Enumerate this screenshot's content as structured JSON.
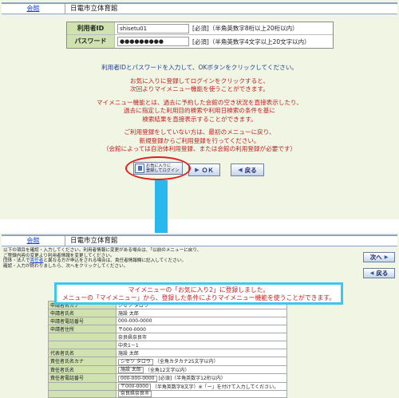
{
  "top": {
    "header": {
      "link": "会館",
      "title": "日電市立体育館"
    },
    "login": {
      "id_label": "利用者ID",
      "id_value": "shisetu01",
      "id_hint": "[必須]（半角英数字8桁以上20桁以内）",
      "pw_label": "パスワード",
      "pw_value": "●●●●●●●●●",
      "pw_hint": "[必須]（半角英数字4文字以上20文字以内）"
    },
    "messages": {
      "line1": "利用者IDとパスワードを入力して、OKボタンをクリックしてください。",
      "line2": "お気に入りに登録してログインをクリックすると、",
      "line3": "次回よりマイメニュー機能を使うことができます。",
      "line4": "マイメニュー機能とは、過去に予約した会館の空き状況を直接表示したり、",
      "line5": "過去に指定した利用目的検索や利用日検索の条件を基に",
      "line6": "検索結果を直接表示することができます。",
      "line7": "ご利用登録をしていない方は、最初のメニューに戻り、",
      "line8": "新規登録からご利用登録を行ってください。",
      "line9": "（会館によっては自治体利用登録、または会館の利用登録が必要です）"
    },
    "buttons": {
      "fav_line1": "お気に入りに",
      "fav_line2": "登録してログイン",
      "ok": "ＯＫ",
      "back": "戻る"
    },
    "colors": {
      "highlight_oval": "#e02020",
      "arrow": "#29b8ee"
    }
  },
  "bottom": {
    "header": {
      "link": "会館",
      "title": "日電市立体育館"
    },
    "desc": {
      "line1": "以下の項目を確認・入力してください。利用者情報に変更がある場合は、「以前のメニューに戻り、",
      "line2": "ご登録内容の変更より利用者情報を変更してください。",
      "line3a": "団体・法人で",
      "line3link": "責任者",
      "line3b": "と異なる方が申込をされる場合は、責任者情報欄に記入してください。",
      "line4": "確認・入力が終わりましたら、次へをクリックしてください。"
    },
    "buttons": {
      "next": "次へ",
      "back": "戻る"
    },
    "callout": {
      "line1": "マイメニューの「お気に入り2」に登録しました。",
      "line2": "メニューの「マイメニュー」から、登録した条件によりマイメニュー機能を使うことができます。"
    },
    "rows": [
      {
        "key": "申請者名カナ",
        "value": "シセツ タロウ"
      },
      {
        "key": "申請者氏名",
        "value": "施設 太郎"
      },
      {
        "key": "申請者電話番号",
        "value": "000-000-0000"
      },
      {
        "key": "申請者住所",
        "value": "〒000-0000"
      },
      {
        "key": "",
        "value": "奈良県奈良市"
      },
      {
        "key": "",
        "value": "中央1－1"
      },
      {
        "key": "代表者氏名",
        "value": "施設 太郎"
      },
      {
        "key": "責任者氏名カナ",
        "value": "シセツ タロウ",
        "hint": "（全角カタカナ25文字以内）"
      },
      {
        "key": "責任者氏名",
        "value": "施設 太郎",
        "hint": "（全角12文字以内）"
      },
      {
        "key": "責任者電話番号",
        "value": "000-000-0000",
        "hint": "[必須]（半角英数字12桁以内）"
      },
      {
        "key": "",
        "value": "〒000-0000",
        "hint": "（半角英数字8文字）※「ー」を付けて入力してください。"
      },
      {
        "key": "",
        "value": "奈良県奈良市"
      }
    ]
  }
}
